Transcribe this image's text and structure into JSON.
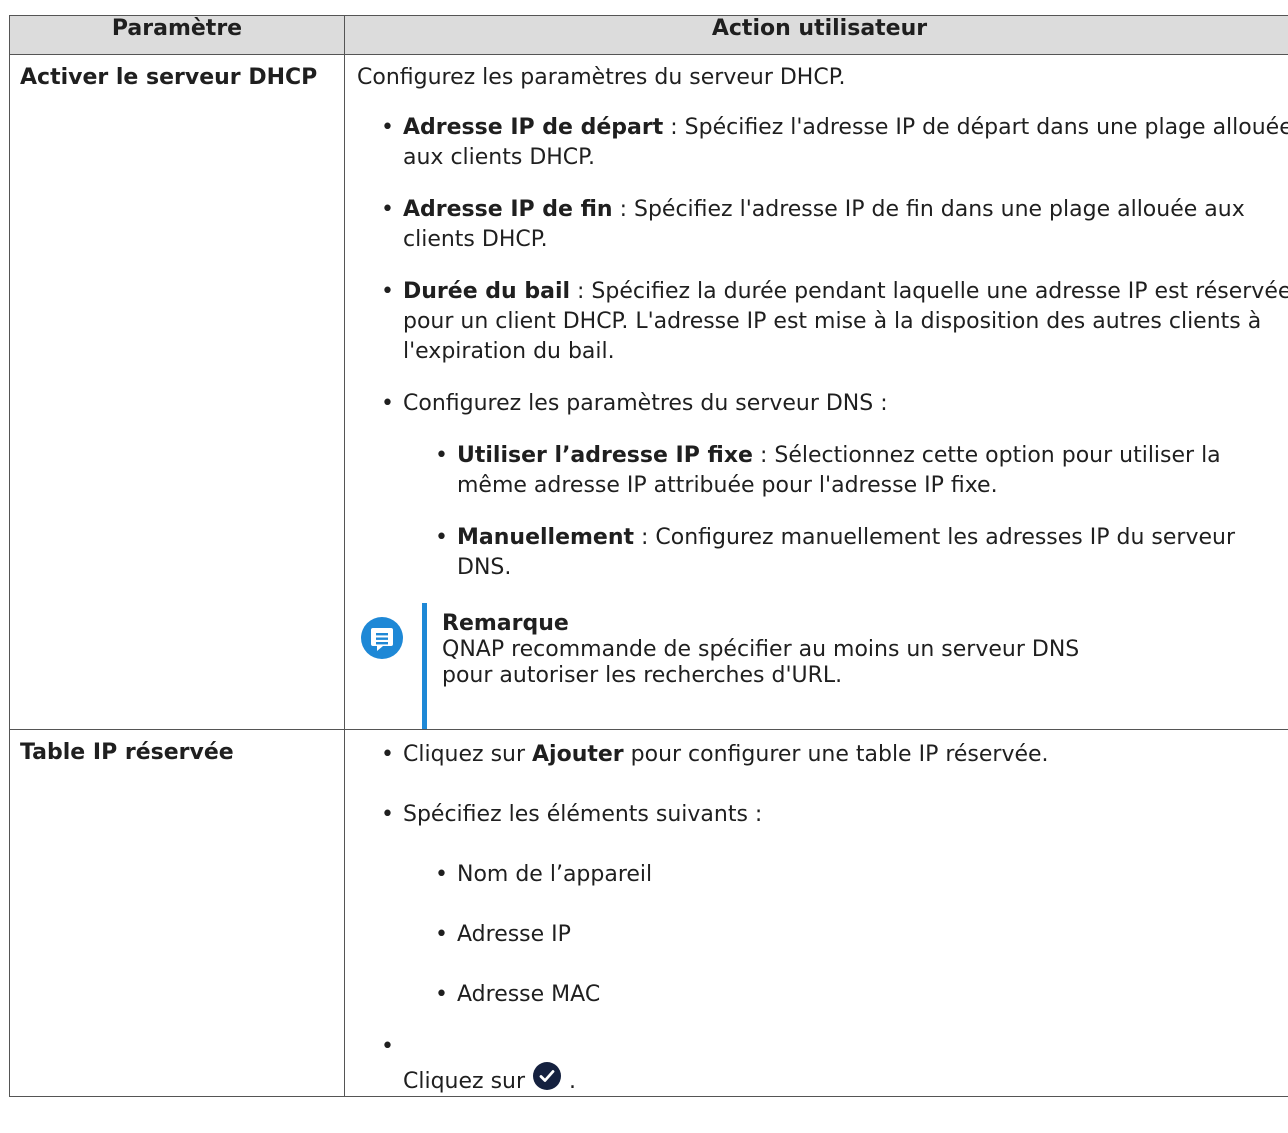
{
  "table": {
    "headers": [
      "Paramètre",
      "Action utilisateur"
    ],
    "row1": {
      "param": "Activer le serveur DHCP",
      "intro": "Configurez les paramètres du serveur DHCP.",
      "items": [
        {
          "term": "Adresse IP de départ",
          "desc": " : Spécifiez l'adresse IP de départ dans une plage allouée aux clients DHCP."
        },
        {
          "term": "Adresse IP de fin",
          "desc": " : Spécifiez l'adresse IP de fin dans une plage allouée aux clients DHCP."
        },
        {
          "term": "Durée du bail",
          "desc": " : Spécifiez la durée pendant laquelle une adresse IP est réservée pour un client DHCP. L'adresse IP est mise à la disposition des autres clients à l'expiration du bail."
        }
      ],
      "dns_intro": "Configurez les paramètres du serveur DNS :",
      "dns_items": [
        {
          "term": "Utiliser l’adresse IP fixe",
          "desc": " : Sélectionnez cette option pour utiliser la même adresse IP attribuée pour l'adresse IP fixe."
        },
        {
          "term": "Manuellement",
          "desc": " : Configurez manuellement les adresses IP du serveur DNS."
        }
      ],
      "note": {
        "icon": "note-icon",
        "accent": "#1e88d6",
        "title": "Remarque",
        "line1": "QNAP recommande de spécifier au moins un serveur DNS",
        "line2": "pour autoriser les recherches d'URL."
      }
    },
    "row2": {
      "param": "Table IP réservée",
      "add": {
        "before": "Cliquez sur ",
        "term": "Ajouter",
        "after": " pour configurer une table IP réservée."
      },
      "specify": "Spécifiez les éléments suivants :",
      "fields": [
        "Nom de l’appareil",
        "Adresse IP",
        "Adresse MAC"
      ],
      "confirm": {
        "before": "Cliquez sur",
        "after": ".",
        "icon": "check-circle-icon"
      }
    }
  }
}
